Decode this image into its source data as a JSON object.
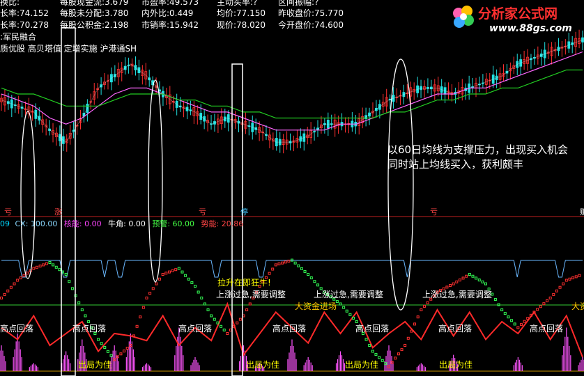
{
  "header": {
    "row0": [
      "换比:",
      "每股现金流:3.679",
      "市盈率:49.573",
      "主动买率:?",
      "区间振幅:?"
    ],
    "row1": [
      "长率:74.152",
      "每股未分配:3.780",
      "内外比:0.449",
      "均价:77.150",
      "昨收盘价:75.770"
    ],
    "row2": [
      "长率:70.278",
      "每股公积金:2.198",
      "市销率:15.942",
      "现价:78.020",
      "今开盘价:74.600"
    ],
    "tags1": ":军民融合",
    "tags2": "质优股 高贝塔值 定增实施 沪港通SH"
  },
  "logo": {
    "line1": "分析家公式网",
    "line2": "www.88gs.com"
  },
  "annotation": {
    "line1": "以60日均线为支撑压力，出现买入机会",
    "line2": "同时站上均线买入，获利颇丰"
  },
  "indicator_legend": [
    {
      "text": "09",
      "color": "#00d8ff"
    },
    {
      "text": "CX: 100.00",
      "color": "#8ad8ff"
    },
    {
      "text": "核能: 0.00",
      "color": "#ff44ff"
    },
    {
      "text": "牛角: 0.00",
      "color": "#ffffff"
    },
    {
      "text": "预警: 60.00",
      "color": "#44ff44"
    },
    {
      "text": "势能: 20.86",
      "color": "#ff4444"
    }
  ],
  "markers": [
    {
      "text": "亏",
      "color": "#ff4444"
    },
    {
      "text": "涨",
      "color": "#ff4444"
    },
    {
      "text": "亏",
      "color": "#ff4444"
    },
    {
      "text": "停",
      "color": "#40c8ff"
    },
    {
      "text": "亏",
      "color": "#ff4444"
    },
    {
      "text": "贩",
      "color": "#ffffff"
    }
  ],
  "chart_labels": [
    {
      "text": "拉升在即狂牛!",
      "color": "#ffff00"
    },
    {
      "text": "上涨过急,需要调整",
      "color": "#ffffff"
    },
    {
      "text": "上涨过急,需要调整",
      "color": "#ffffff"
    },
    {
      "text": "上涨过急,需要调整",
      "color": "#ffffff"
    },
    {
      "text": "大资金进场",
      "color": "#ffcc00"
    },
    {
      "text": "大资",
      "color": "#ffcc00"
    },
    {
      "text": "高点回落",
      "color": "#ffffff"
    },
    {
      "text": "高点回落",
      "color": "#ffffff"
    },
    {
      "text": "高点回落",
      "color": "#ffffff"
    },
    {
      "text": "高点回落",
      "color": "#ffffff"
    },
    {
      "text": "高点回落",
      "color": "#ffffff"
    },
    {
      "text": "高点回落",
      "color": "#ffffff"
    },
    {
      "text": "高点回落",
      "color": "#ffffff"
    },
    {
      "text": "出局为佳",
      "color": "#ffff00"
    },
    {
      "text": "出局为佳",
      "color": "#ffff00"
    },
    {
      "text": "出局为佳",
      "color": "#ffff00"
    },
    {
      "text": "出局为佳",
      "color": "#ffff00"
    }
  ],
  "chart_data": [
    {
      "type": "line",
      "panel": "price",
      "x": [
        0,
        10,
        20,
        30,
        40,
        50,
        60,
        70,
        80,
        90,
        100,
        110,
        120,
        130,
        140,
        150,
        160,
        170,
        180,
        190,
        200,
        210,
        220,
        230,
        240,
        250,
        260,
        270,
        280,
        290,
        300,
        310,
        320,
        330,
        340,
        350,
        360
      ],
      "series": [
        {
          "values": [
            70,
            69,
            68,
            65,
            63,
            67,
            72,
            74,
            76,
            74,
            71,
            69,
            68,
            66,
            67,
            66,
            65,
            63,
            63,
            64,
            66,
            66,
            66,
            68,
            70,
            71,
            72,
            72,
            71,
            72,
            73,
            74,
            76,
            77,
            78,
            79,
            80
          ]
        },
        {
          "values": [
            71,
            70,
            69,
            67,
            66,
            67,
            69,
            71,
            72,
            72,
            71,
            70,
            69,
            68,
            68,
            67,
            66,
            65,
            65,
            65,
            65,
            66,
            66,
            67,
            68,
            69,
            70,
            71,
            71,
            72,
            72,
            73,
            74,
            75,
            76,
            77,
            78
          ]
        },
        {
          "values": [
            72,
            71,
            71,
            70,
            69,
            69,
            69,
            70,
            71,
            71,
            71,
            70,
            70,
            69,
            69,
            68,
            68,
            67,
            67,
            67,
            67,
            67,
            67,
            67,
            68,
            68,
            69,
            70,
            70,
            71,
            71,
            72,
            72,
            73,
            74,
            75,
            75
          ]
        }
      ],
      "colors": [
        "#ffffff",
        "#ff66ff",
        "#22cc22"
      ]
    },
    {
      "type": "line",
      "panel": "indicator",
      "ylim": [
        0,
        100
      ],
      "x": [
        0,
        10,
        20,
        30,
        40,
        50,
        60,
        70,
        80,
        90,
        100,
        110,
        120,
        130,
        140,
        150,
        160,
        170,
        180,
        190,
        200,
        210,
        220,
        230,
        240,
        250,
        260,
        270,
        280,
        290,
        300,
        310,
        320,
        330,
        340,
        350,
        360
      ],
      "series": [
        {
          "values": [
            60,
            75,
            85,
            90,
            80,
            50,
            25,
            8,
            20,
            60,
            80,
            85,
            70,
            45,
            30,
            45,
            70,
            88,
            92,
            80,
            65,
            55,
            40,
            15,
            2,
            20,
            50,
            65,
            72,
            80,
            72,
            50,
            35,
            48,
            60,
            75,
            80
          ]
        },
        {
          "values": [
            35,
            25,
            45,
            20,
            30,
            40,
            15,
            30,
            28,
            24,
            45,
            20,
            35,
            24,
            55,
            12,
            30,
            48,
            35,
            22,
            48,
            30,
            48,
            18,
            30,
            40,
            25,
            50,
            28,
            48,
            25,
            40,
            30,
            48,
            25,
            45,
            10
          ]
        },
        {
          "values": [
            20,
            30,
            5,
            0,
            15,
            25,
            0,
            20,
            30,
            5,
            0,
            35,
            10,
            0,
            0,
            20,
            5,
            0,
            25,
            10,
            0,
            15,
            0,
            0,
            20,
            0,
            5,
            0,
            12,
            0,
            0,
            0,
            10,
            0,
            0,
            35,
            10
          ]
        }
      ],
      "colors": [
        "#33ff55",
        "#ff2a2a",
        "#ff55ff"
      ]
    }
  ]
}
